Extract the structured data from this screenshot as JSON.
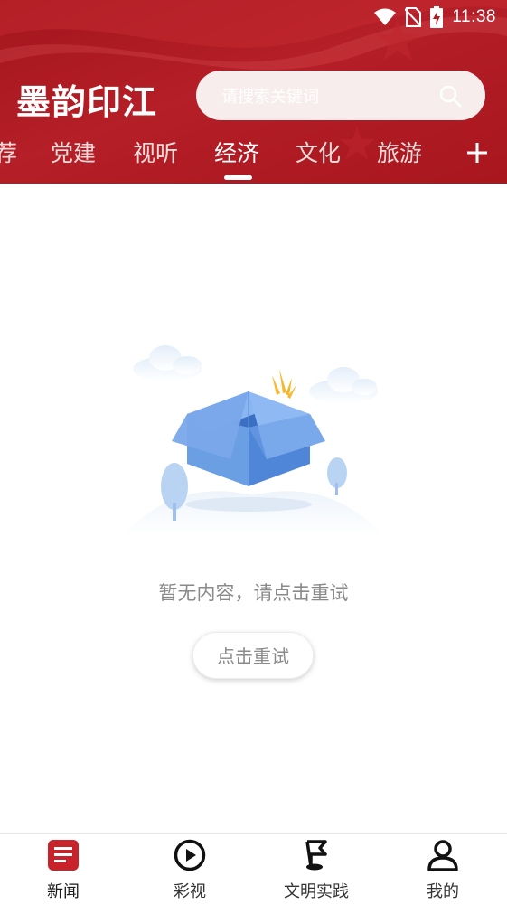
{
  "status_bar": {
    "time": "11:38"
  },
  "header": {
    "app_title": "墨韵印江",
    "search_placeholder": "请搜索关键词"
  },
  "tabs": [
    {
      "label": "荐"
    },
    {
      "label": "党建"
    },
    {
      "label": "视听"
    },
    {
      "label": "经济",
      "active": true
    },
    {
      "label": "文化"
    },
    {
      "label": "旅游"
    }
  ],
  "empty_state": {
    "message": "暂无内容，请点击重试",
    "retry_label": "点击重试"
  },
  "bottom_nav": [
    {
      "label": "新闻",
      "icon": "news-icon",
      "active": true
    },
    {
      "label": "彩视",
      "icon": "play-icon"
    },
    {
      "label": "文明实践",
      "icon": "flag-icon"
    },
    {
      "label": "我的",
      "icon": "profile-icon"
    }
  ],
  "colors": {
    "brand_red": "#b01c24",
    "accent": "#c8222b",
    "text_gray": "#8a8a8a"
  }
}
